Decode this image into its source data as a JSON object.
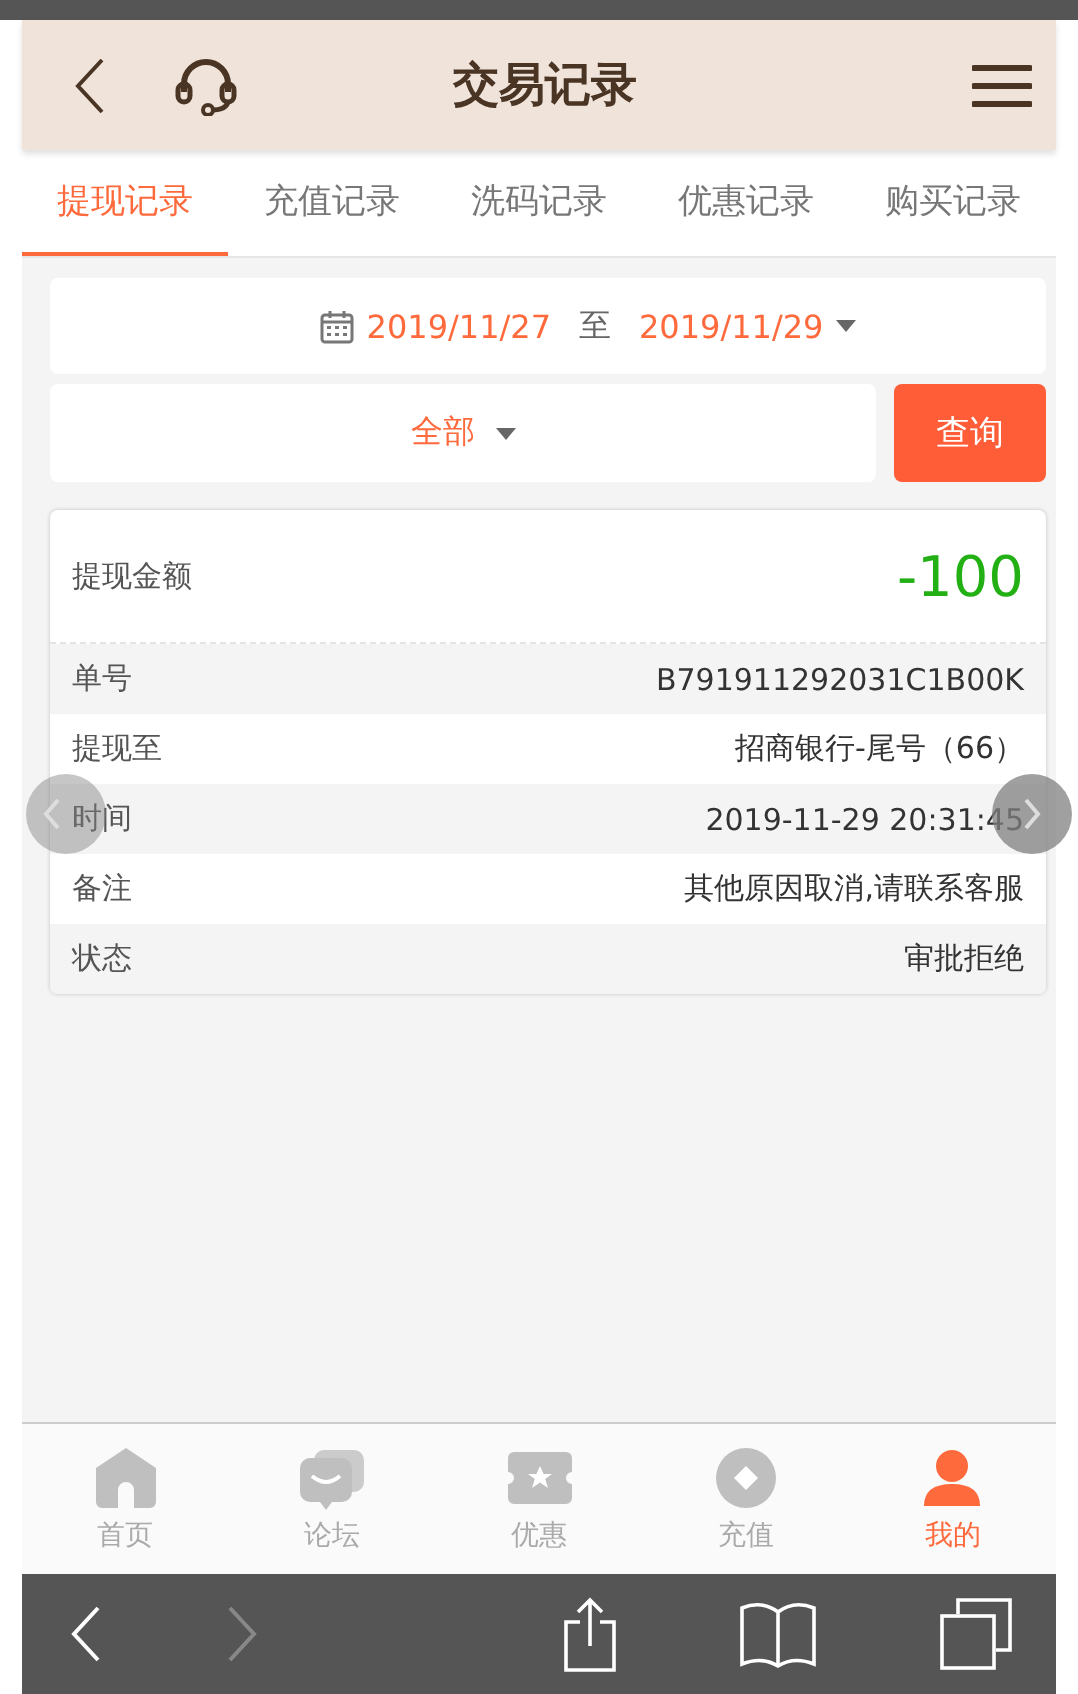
{
  "header": {
    "title": "交易记录"
  },
  "tabs": [
    {
      "label": "提现记录",
      "selected": true
    },
    {
      "label": "充值记录",
      "selected": false
    },
    {
      "label": "洗码记录",
      "selected": false
    },
    {
      "label": "优惠记录",
      "selected": false
    },
    {
      "label": "购买记录",
      "selected": false
    }
  ],
  "date_filter": {
    "start": "2019/11/27",
    "separator": "至",
    "end": "2019/11/29"
  },
  "type_filter": {
    "value": "全部"
  },
  "query_button": "查询",
  "record": {
    "amount_label": "提现金额",
    "amount": "-100",
    "rows": [
      {
        "label": "单号",
        "value": "B791911292031C1B00K"
      },
      {
        "label": "提现至",
        "value": "招商银行-尾号（66）"
      },
      {
        "label": "时间",
        "value": "2019-11-29 20:31:45"
      },
      {
        "label": "备注",
        "value": "其他原因取消,请联系客服"
      },
      {
        "label": "状态",
        "value": "审批拒绝"
      }
    ]
  },
  "bottom_nav": [
    {
      "kind": "home",
      "label": "首页",
      "selected": false
    },
    {
      "kind": "forum",
      "label": "论坛",
      "selected": false
    },
    {
      "kind": "coupon",
      "label": "优惠",
      "selected": false
    },
    {
      "kind": "recharge",
      "label": "充值",
      "selected": false
    },
    {
      "kind": "me",
      "label": "我的",
      "selected": true
    }
  ],
  "browser_toolbar": [
    {
      "kind": "back",
      "disabled": false
    },
    {
      "kind": "forward",
      "disabled": true
    },
    {
      "kind": "share",
      "disabled": false
    },
    {
      "kind": "bookmarks",
      "disabled": false
    },
    {
      "kind": "tabs",
      "disabled": false
    }
  ]
}
